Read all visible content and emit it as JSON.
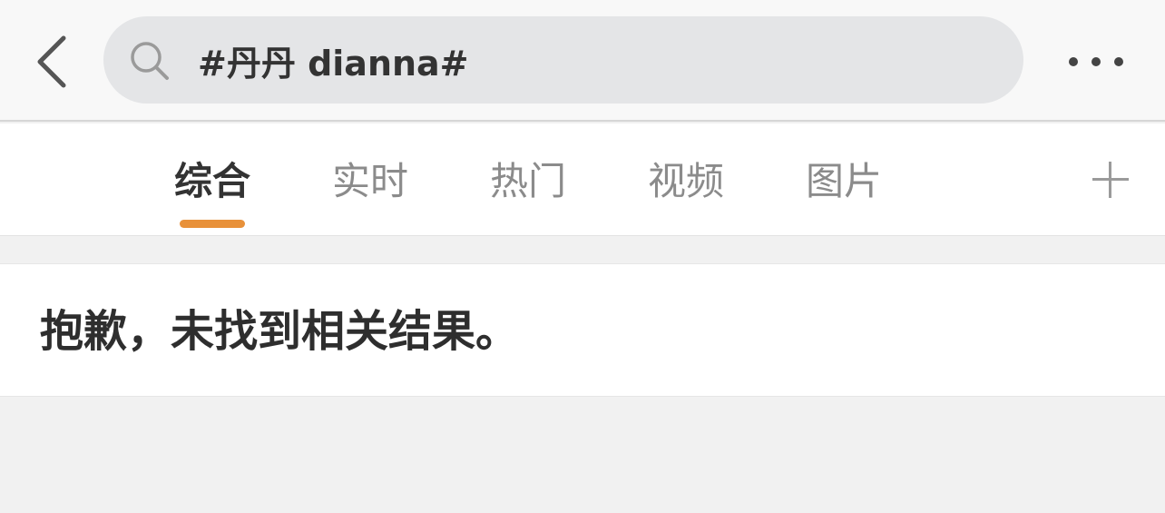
{
  "header": {
    "back_icon": "chevron-left-icon",
    "search": {
      "icon": "search-icon",
      "query": "#丹丹 dianna#"
    },
    "more_icon": "more-horizontal-icon"
  },
  "tabs": [
    {
      "label": "综合",
      "active": true
    },
    {
      "label": "实时",
      "active": false
    },
    {
      "label": "热门",
      "active": false
    },
    {
      "label": "视频",
      "active": false
    },
    {
      "label": "图片",
      "active": false
    }
  ],
  "add_tab_icon": "plus-icon",
  "results": {
    "empty_message": "抱歉，未找到相关结果。"
  },
  "colors": {
    "accent": "#e8913a",
    "search_bg": "#e4e5e7",
    "page_bg": "#f1f1f1"
  }
}
